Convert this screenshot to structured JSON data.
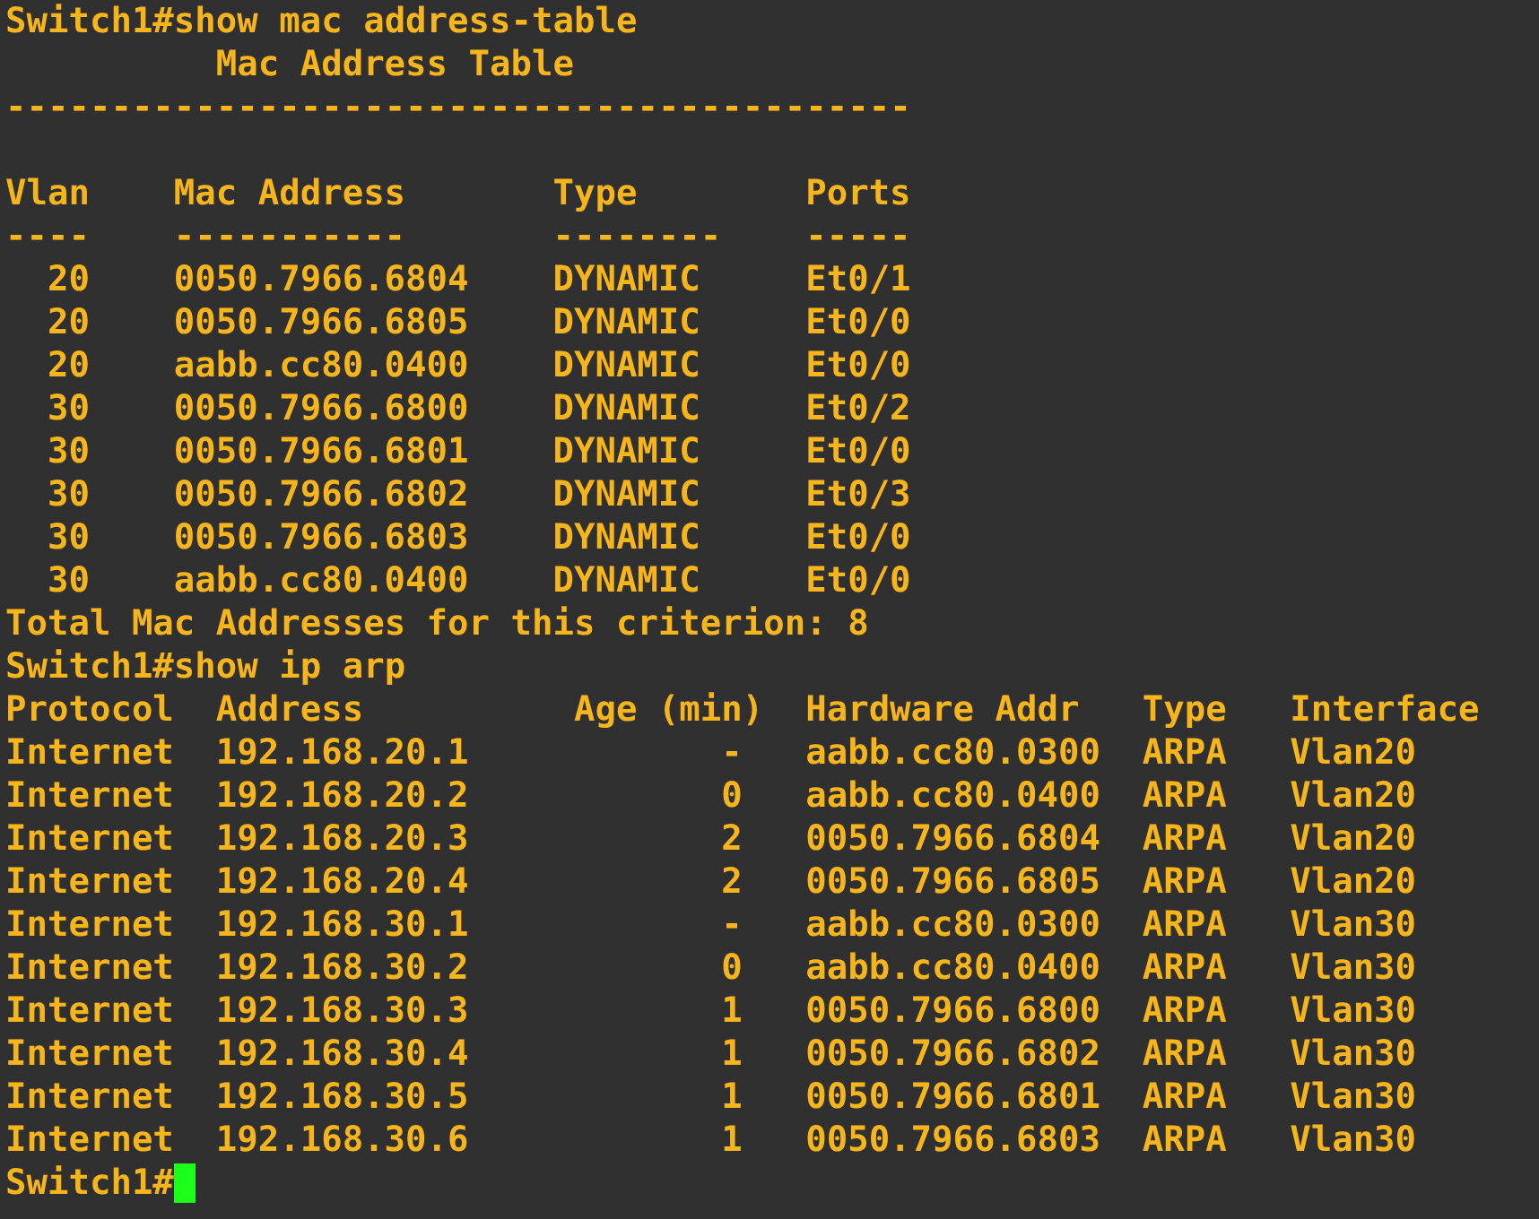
{
  "terminal": {
    "blocks": [
      {
        "kind": "command",
        "prompt": "Switch1#",
        "command": "show mac address-table"
      },
      {
        "kind": "title",
        "text": "Mac Address Table"
      },
      {
        "kind": "separator",
        "text": "-------------------------------------------"
      },
      {
        "kind": "mac_table",
        "columns": [
          "Vlan",
          "Mac Address",
          "Type",
          "Ports"
        ],
        "underlines": [
          "----",
          "-----------",
          "--------",
          "-----"
        ],
        "rows": [
          {
            "vlan": "20",
            "mac_address": "0050.7966.6804",
            "type": "DYNAMIC",
            "ports": "Et0/1"
          },
          {
            "vlan": "20",
            "mac_address": "0050.7966.6805",
            "type": "DYNAMIC",
            "ports": "Et0/0"
          },
          {
            "vlan": "20",
            "mac_address": "aabb.cc80.0400",
            "type": "DYNAMIC",
            "ports": "Et0/0"
          },
          {
            "vlan": "30",
            "mac_address": "0050.7966.6800",
            "type": "DYNAMIC",
            "ports": "Et0/2"
          },
          {
            "vlan": "30",
            "mac_address": "0050.7966.6801",
            "type": "DYNAMIC",
            "ports": "Et0/0"
          },
          {
            "vlan": "30",
            "mac_address": "0050.7966.6802",
            "type": "DYNAMIC",
            "ports": "Et0/3"
          },
          {
            "vlan": "30",
            "mac_address": "0050.7966.6803",
            "type": "DYNAMIC",
            "ports": "Et0/0"
          },
          {
            "vlan": "30",
            "mac_address": "aabb.cc80.0400",
            "type": "DYNAMIC",
            "ports": "Et0/0"
          }
        ]
      },
      {
        "kind": "summary",
        "text": "Total Mac Addresses for this criterion: 8"
      },
      {
        "kind": "command",
        "prompt": "Switch1#",
        "command": "show ip arp"
      },
      {
        "kind": "arp_table",
        "columns": [
          "Protocol",
          "Address",
          "Age (min)",
          "Hardware Addr",
          "Type",
          "Interface"
        ],
        "rows": [
          {
            "protocol": "Internet",
            "address": "192.168.20.1",
            "age": "-",
            "hardware_addr": "aabb.cc80.0300",
            "type": "ARPA",
            "interface": "Vlan20"
          },
          {
            "protocol": "Internet",
            "address": "192.168.20.2",
            "age": "0",
            "hardware_addr": "aabb.cc80.0400",
            "type": "ARPA",
            "interface": "Vlan20"
          },
          {
            "protocol": "Internet",
            "address": "192.168.20.3",
            "age": "2",
            "hardware_addr": "0050.7966.6804",
            "type": "ARPA",
            "interface": "Vlan20"
          },
          {
            "protocol": "Internet",
            "address": "192.168.20.4",
            "age": "2",
            "hardware_addr": "0050.7966.6805",
            "type": "ARPA",
            "interface": "Vlan20"
          },
          {
            "protocol": "Internet",
            "address": "192.168.30.1",
            "age": "-",
            "hardware_addr": "aabb.cc80.0300",
            "type": "ARPA",
            "interface": "Vlan30"
          },
          {
            "protocol": "Internet",
            "address": "192.168.30.2",
            "age": "0",
            "hardware_addr": "aabb.cc80.0400",
            "type": "ARPA",
            "interface": "Vlan30"
          },
          {
            "protocol": "Internet",
            "address": "192.168.30.3",
            "age": "1",
            "hardware_addr": "0050.7966.6800",
            "type": "ARPA",
            "interface": "Vlan30"
          },
          {
            "protocol": "Internet",
            "address": "192.168.30.4",
            "age": "1",
            "hardware_addr": "0050.7966.6802",
            "type": "ARPA",
            "interface": "Vlan30"
          },
          {
            "protocol": "Internet",
            "address": "192.168.30.5",
            "age": "1",
            "hardware_addr": "0050.7966.6801",
            "type": "ARPA",
            "interface": "Vlan30"
          },
          {
            "protocol": "Internet",
            "address": "192.168.30.6",
            "age": "1",
            "hardware_addr": "0050.7966.6803",
            "type": "ARPA",
            "interface": "Vlan30"
          }
        ]
      },
      {
        "kind": "prompt",
        "prompt": "Switch1#",
        "cursor_visible": true
      }
    ]
  }
}
